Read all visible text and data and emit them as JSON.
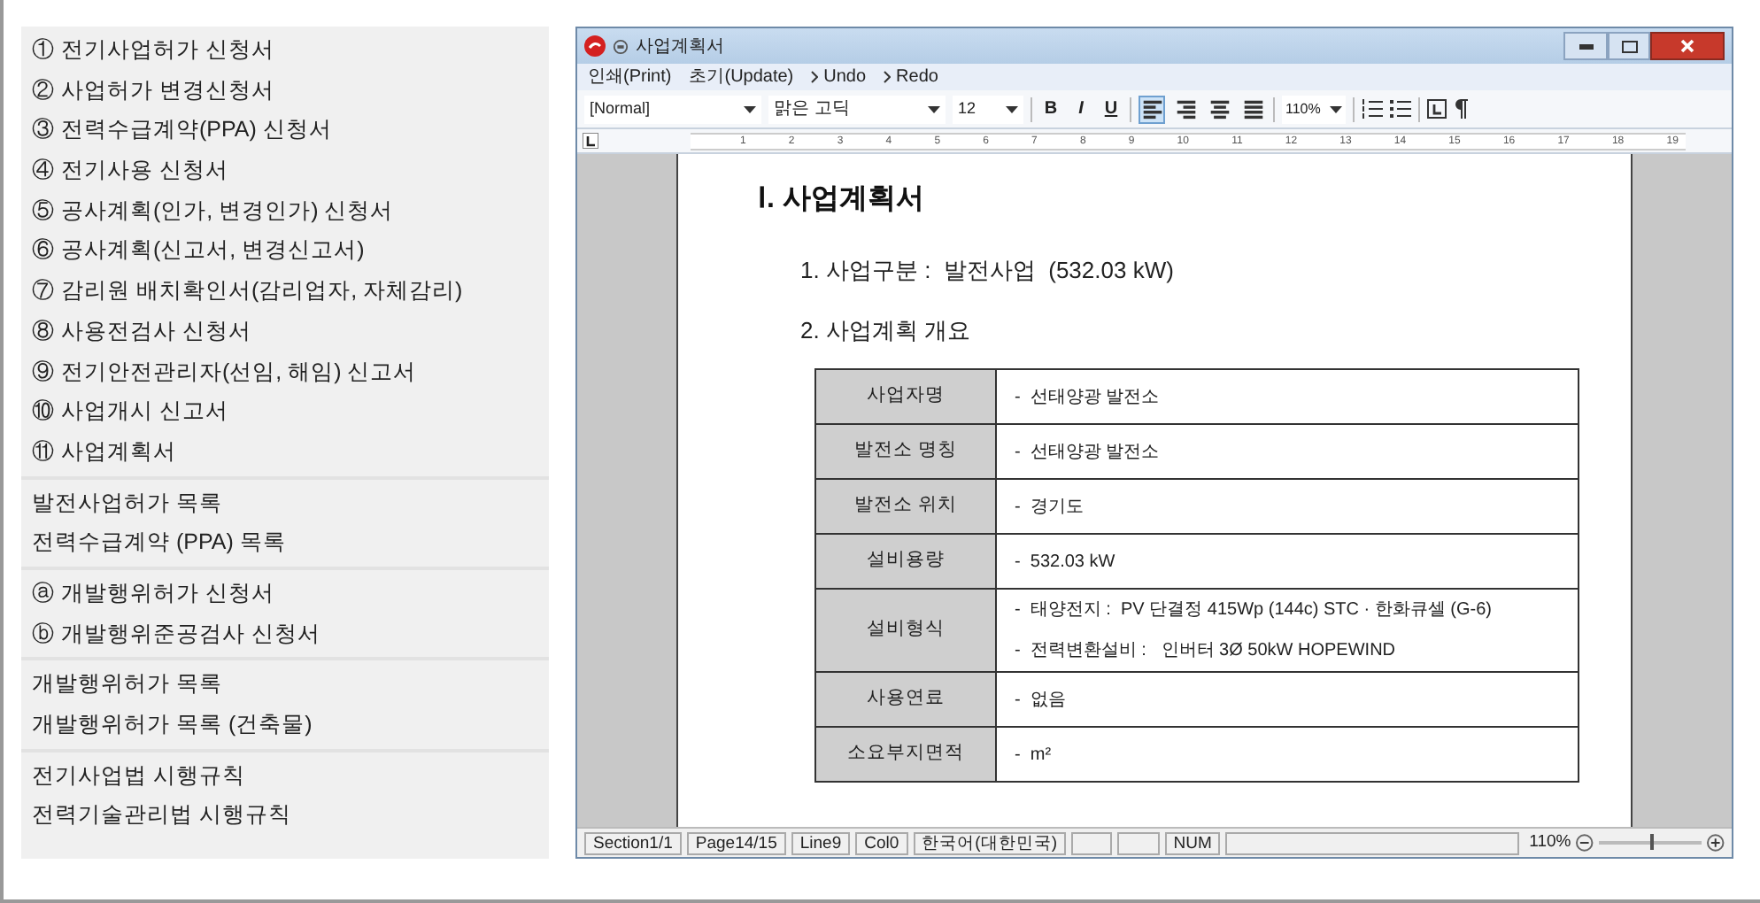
{
  "menu_panel": {
    "groups": [
      [
        "① 전기사업허가 신청서",
        "② 사업허가 변경신청서",
        "③ 전력수급계약(PPA) 신청서",
        "④ 전기사용 신청서",
        "⑤ 공사계획(인가, 변경인가) 신청서",
        "⑥ 공사계획(신고서, 변경신고서)",
        "⑦ 감리원 배치확인서(감리업자, 자체감리)",
        "⑧ 사용전검사 신청서",
        "⑨ 전기안전관리자(선임, 해임) 신고서",
        "⑩ 사업개시 신고서",
        "⑪ 사업계획서"
      ],
      [
        "발전사업허가 목록",
        "전력수급계약 (PPA) 목록"
      ],
      [
        "ⓐ 개발행위허가 신청서",
        "ⓑ 개발행위준공검사 신청서"
      ],
      [
        "개발행위허가 목록",
        "개발행위허가 목록 (건축물)"
      ],
      [
        "전기사업법 시행규칙",
        "전력기술관리법 시행규칙"
      ]
    ]
  },
  "window": {
    "title": "사업계획서",
    "menu": [
      {
        "label": "인쇄(Print)",
        "kind": "plain"
      },
      {
        "label": "초기(Update)",
        "kind": "plain"
      },
      {
        "label": "Undo",
        "kind": "arrow"
      },
      {
        "label": "Redo",
        "kind": "arrow"
      }
    ],
    "toolbar": {
      "style": "[Normal]",
      "font": "맑은 고딕",
      "size": "12",
      "format": [
        "B",
        "I",
        "U"
      ],
      "align": [
        {
          "kind": "left",
          "selected": true
        },
        {
          "kind": "right",
          "selected": false
        },
        {
          "kind": "center",
          "selected": false
        },
        {
          "kind": "justify",
          "selected": false
        }
      ],
      "zoom": "110%"
    },
    "ruler": [
      "1",
      "2",
      "3",
      "4",
      "5",
      "6",
      "7",
      "8",
      "9",
      "10",
      "11",
      "12",
      "13",
      "14",
      "15",
      "16",
      "17",
      "18",
      "19"
    ],
    "document": {
      "heading": "Ⅰ. 사업계획서",
      "items": [
        "1. 사업구분 :  발전사업  (532.03 kW)",
        "2. 사업계획 개요"
      ],
      "table": [
        {
          "label": "사업자명",
          "values": [
            "-  선태양광 발전소"
          ]
        },
        {
          "label": "발전소 명칭",
          "values": [
            "-  선태양광 발전소"
          ]
        },
        {
          "label": "발전소 위치",
          "values": [
            "-  경기도"
          ]
        },
        {
          "label": "설비용량",
          "values": [
            "-  532.03 kW"
          ]
        },
        {
          "label": "설비형식",
          "values": [
            "-  태양전지 :  PV 단결정 415Wp (144c) STC · 한화큐셀 (G-6)",
            "-  전력변환설비 :   인버터 3Ø 50kW HOPEWIND"
          ]
        },
        {
          "label": "사용연료",
          "values": [
            "-  없음"
          ]
        },
        {
          "label": "소요부지면적",
          "values": [
            "-  m²"
          ]
        }
      ]
    },
    "status_bar": {
      "cells": [
        {
          "kind": "text",
          "text": "Section1/1"
        },
        {
          "kind": "text",
          "text": "Page14/15"
        },
        {
          "kind": "text",
          "text": "Line9"
        },
        {
          "kind": "text",
          "text": "Col0"
        },
        {
          "kind": "text",
          "text": "한국어(대한민국)"
        },
        {
          "kind": "blank"
        },
        {
          "kind": "blank"
        },
        {
          "kind": "text",
          "text": "NUM"
        },
        {
          "kind": "wide"
        }
      ],
      "zoom": "110%",
      "zoom_slider": {
        "level": 0.5
      }
    }
  }
}
